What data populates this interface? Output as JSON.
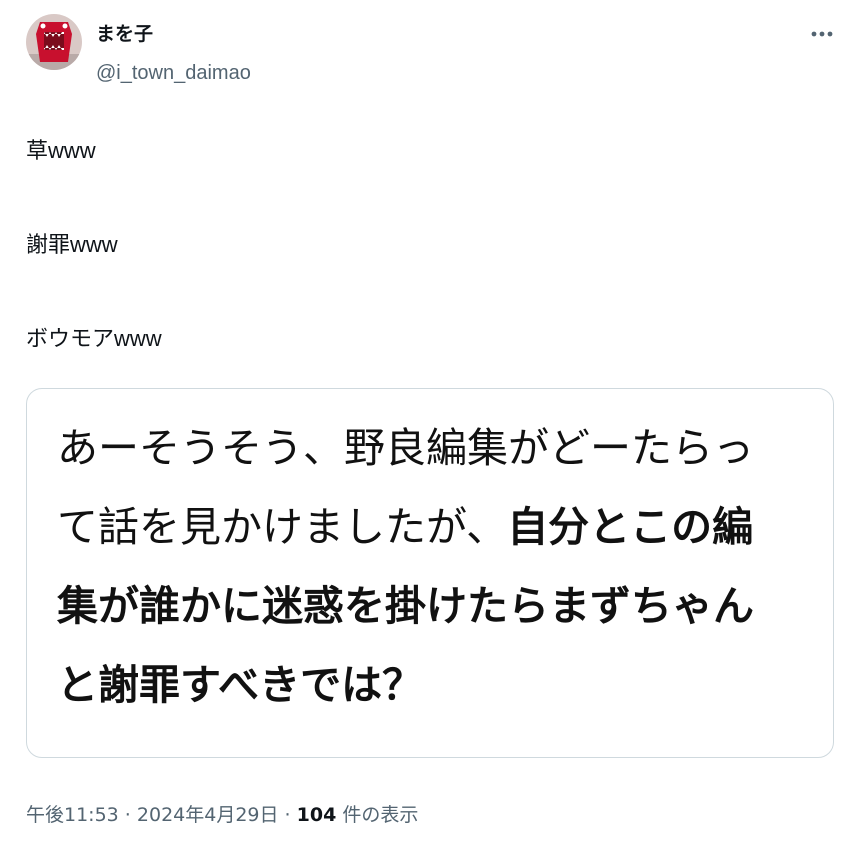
{
  "user": {
    "display_name": "まを子",
    "handle": "@i_town_daimao",
    "avatar_icon": "avatar-icon"
  },
  "more_icon": "more-horizontal-icon",
  "tweet": {
    "lines": [
      {
        "jp": "草",
        "ascii": "www"
      },
      {
        "jp": "謝罪",
        "ascii": "www"
      },
      {
        "jp": "ボウモア",
        "ascii": "www"
      }
    ]
  },
  "card": {
    "line1": "あーそうそう、野良編集がどーたらっ",
    "line2_regular": "て話を見かけましたが、",
    "line2_bold": "自分とこの編",
    "line3_bold": "集が誰かに迷惑を掛けたらまずちゃん",
    "line4_bold": "と謝罪すべきでは？"
  },
  "meta": {
    "time": "午後11:53",
    "separator1": " · ",
    "date": "2024年4月29日",
    "separator2": " · ",
    "views_count": "104",
    "views_label": " 件の表示"
  },
  "colors": {
    "text": "#0f1419",
    "secondary": "#536471",
    "border": "#cfd9de",
    "avatar_red": "#c8102e"
  }
}
